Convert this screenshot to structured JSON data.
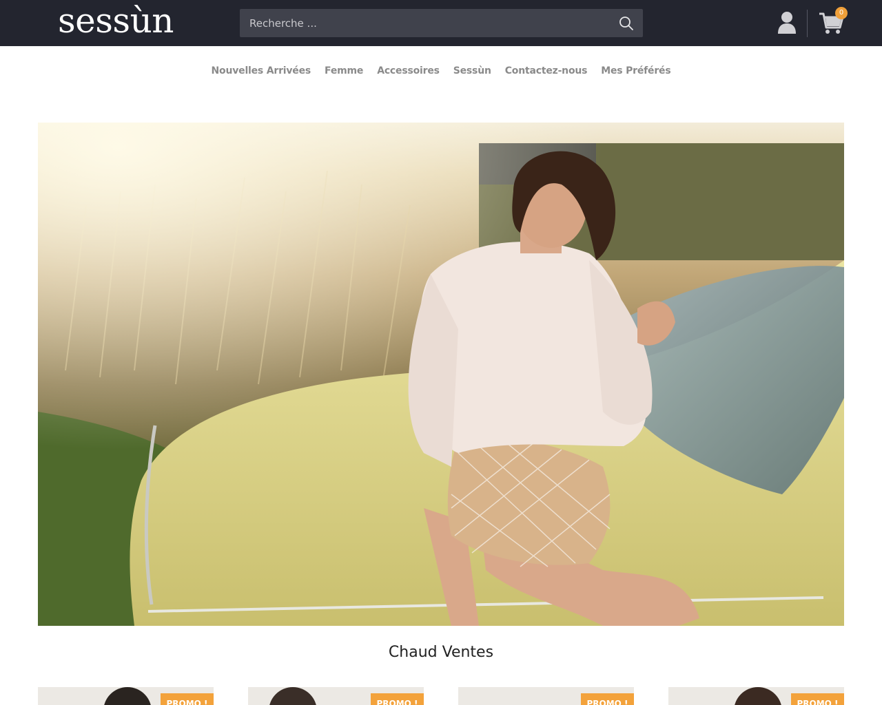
{
  "header": {
    "logo_text": "sessùn",
    "search_placeholder": "Recherche ...",
    "cart_count": "0",
    "colors": {
      "bar": "#23252f",
      "search_bg": "#40424c",
      "badge": "#f0a03a"
    },
    "icons": [
      "search-icon",
      "user-icon",
      "cart-icon"
    ]
  },
  "nav": {
    "items": [
      {
        "label": "Nouvelles Arrivées"
      },
      {
        "label": "Femme"
      },
      {
        "label": "Accessoires"
      },
      {
        "label": "Sessùn"
      },
      {
        "label": "Contactez-nous"
      },
      {
        "label": "Mes Préférés"
      }
    ]
  },
  "hero": {
    "alt": "Woman in a white sweater and patterned shorts leaning on a yellow vintage car in a sunlit field"
  },
  "section": {
    "title": "Chaud Ventes"
  },
  "products": [
    {
      "badge": "PROMO !"
    },
    {
      "badge": "PROMO !"
    },
    {
      "badge": "PROMO !"
    },
    {
      "badge": "PROMO !"
    }
  ]
}
